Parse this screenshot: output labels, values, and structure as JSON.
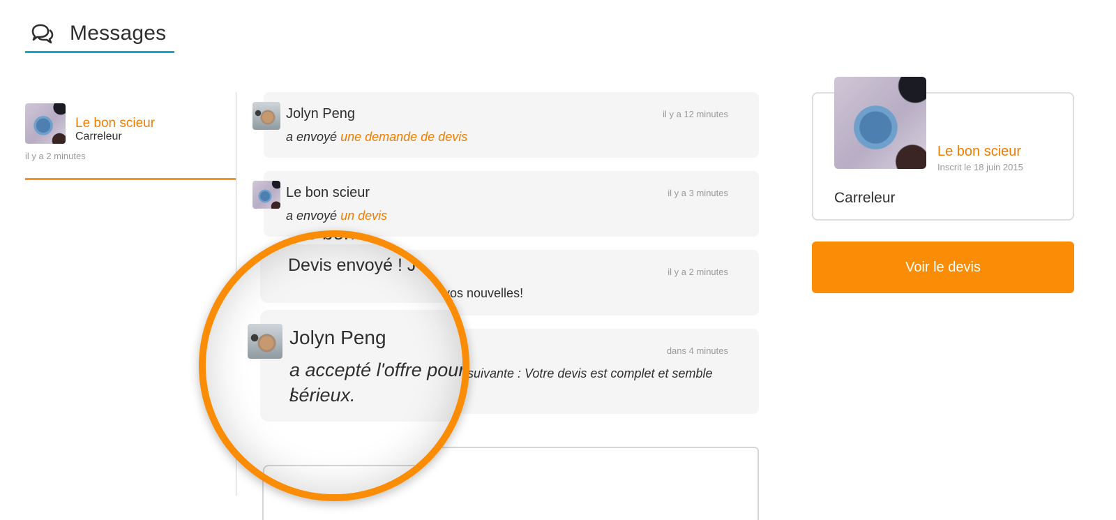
{
  "header": {
    "title": "Messages",
    "icon": "chat-bubbles-icon",
    "accent": "#17a6c6"
  },
  "conversations": [
    {
      "name": "Le bon scieur",
      "subtitle": "Carreleur",
      "time": "il y a 2 minutes"
    }
  ],
  "messages": [
    {
      "author": "Jolyn Peng",
      "time": "il y a 12 minutes",
      "prefix": "a envoyé ",
      "link": "une demande de devis"
    },
    {
      "author": "Le bon scieur",
      "time": "il y a 3 minutes",
      "prefix": "a envoyé ",
      "link": "un devis"
    },
    {
      "author": "Le bon scieur",
      "time": "il y a 2 minutes",
      "text_visible": "vos nouvelles!"
    },
    {
      "author": "Jolyn Peng",
      "time": "dans 4 minutes",
      "text_line1": "suivante : Votre devis est complet et semble"
    }
  ],
  "magnifier": {
    "partial_author": "Le bon sc",
    "partial_text": "Devis envoyé ! J'a",
    "author": "Jolyn Peng",
    "text_line1": "a accepté l'offre pour l",
    "text_line2": "sérieux."
  },
  "profile": {
    "name": "Le bon scieur",
    "since": "Inscrit le 18 juin 2015",
    "job": "Carreleur"
  },
  "cta_label": "Voir le devis",
  "colors": {
    "brand_orange": "#fb8c05",
    "link_orange": "#ef7d00",
    "bubble_bg": "#f5f5f5"
  }
}
